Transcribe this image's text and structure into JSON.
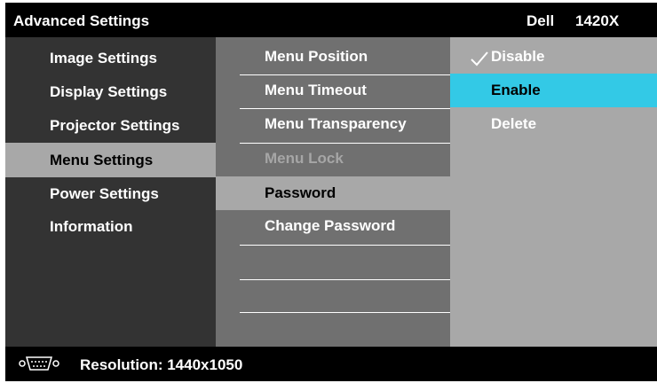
{
  "header": {
    "title": "Advanced Settings",
    "brand": "Dell",
    "model": "1420X"
  },
  "main_menu": {
    "items": [
      {
        "label": "Image Settings",
        "state": "normal"
      },
      {
        "label": "Display Settings",
        "state": "normal"
      },
      {
        "label": "Projector Settings",
        "state": "normal"
      },
      {
        "label": "Menu Settings",
        "state": "selected"
      },
      {
        "label": "Power Settings",
        "state": "normal"
      },
      {
        "label": "Information",
        "state": "normal"
      }
    ]
  },
  "sub_menu": {
    "items": [
      {
        "label": "Menu Position",
        "state": "normal"
      },
      {
        "label": "Menu Timeout",
        "state": "normal"
      },
      {
        "label": "Menu Transparency",
        "state": "normal"
      },
      {
        "label": "Menu Lock",
        "state": "disabled"
      },
      {
        "label": "Password",
        "state": "selected"
      },
      {
        "label": "Change Password",
        "state": "normal"
      }
    ]
  },
  "options": {
    "items": [
      {
        "label": "Disable",
        "checked": true,
        "highlighted": false
      },
      {
        "label": "Enable",
        "checked": false,
        "highlighted": true
      },
      {
        "label": "Delete",
        "checked": false,
        "highlighted": false
      }
    ]
  },
  "status": {
    "icon": "vga-connector-icon",
    "text": "Resolution: 1440x1050"
  },
  "colors": {
    "background": "#000000",
    "main_menu_bg": "#333333",
    "sub_menu_bg": "#707070",
    "options_bg": "#a8a8a8",
    "highlight": "#33c9e6",
    "disabled_text": "#a6a6a6"
  }
}
